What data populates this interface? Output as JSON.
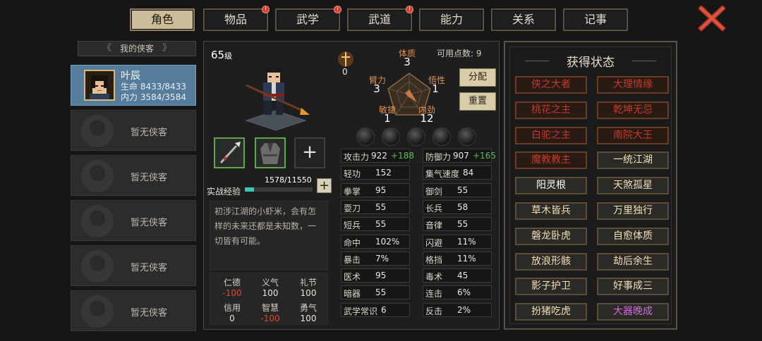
{
  "tabs": [
    {
      "label": "角色",
      "active": true,
      "badge": false
    },
    {
      "label": "物品",
      "active": false,
      "badge": true
    },
    {
      "label": "武学",
      "active": false,
      "badge": true
    },
    {
      "label": "武道",
      "active": false,
      "badge": true
    },
    {
      "label": "能力",
      "active": false,
      "badge": false
    },
    {
      "label": "关系",
      "active": false,
      "badge": false
    },
    {
      "label": "记事",
      "active": false,
      "badge": false
    }
  ],
  "badge_mark": "!",
  "roster": {
    "title": "我的侠客",
    "hero": {
      "name": "叶辰",
      "hp_label": "生命",
      "hp_value": "8433/8433",
      "mp_label": "内力",
      "mp_value": "3584/3584"
    },
    "empty_label": "暂无侠客",
    "empty_slots": 5
  },
  "character": {
    "level": "65",
    "level_suffix": "级",
    "exp_label": "实战经验",
    "exp_text": "1578/11550",
    "exp_current": 1578,
    "exp_max": 11550,
    "description": "初涉江湖的小虾米，会有怎样的未来还都是未知数，一切皆有可能。",
    "icon_value": "0"
  },
  "virtues": [
    {
      "label": "仁德",
      "value": "-100",
      "neg": true
    },
    {
      "label": "义气",
      "value": "100",
      "neg": false
    },
    {
      "label": "礼节",
      "value": "100",
      "neg": false
    },
    {
      "label": "信用",
      "value": "0",
      "neg": false
    },
    {
      "label": "智慧",
      "value": "-100",
      "neg": true
    },
    {
      "label": "勇气",
      "value": "100",
      "neg": false
    }
  ],
  "radar": {
    "available_points_label": "可用点数",
    "available_points": "9",
    "attributes": [
      {
        "label": "体质",
        "value": "3"
      },
      {
        "label": "悟性",
        "value": "1"
      },
      {
        "label": "内劲",
        "value": "12"
      },
      {
        "label": "敏捷",
        "value": "1"
      },
      {
        "label": "臂力",
        "value": "3"
      }
    ]
  },
  "buttons": {
    "allocate": "分配",
    "reset": "重置"
  },
  "stats": [
    {
      "label": "攻击力",
      "value": "922",
      "bonus": "+188"
    },
    {
      "label": "防御力",
      "value": "907",
      "bonus": "+165"
    },
    {
      "label": "轻功",
      "value": "152",
      "bonus": ""
    },
    {
      "label": "集气速度",
      "value": "84",
      "bonus": ""
    },
    {
      "label": "拳掌",
      "value": "95",
      "bonus": ""
    },
    {
      "label": "御剑",
      "value": "55",
      "bonus": ""
    },
    {
      "label": "耍刀",
      "value": "55",
      "bonus": ""
    },
    {
      "label": "长兵",
      "value": "58",
      "bonus": ""
    },
    {
      "label": "短兵",
      "value": "55",
      "bonus": ""
    },
    {
      "label": "音律",
      "value": "55",
      "bonus": ""
    },
    {
      "label": "命中",
      "value": "102%",
      "bonus": ""
    },
    {
      "label": "闪避",
      "value": "11%",
      "bonus": ""
    },
    {
      "label": "暴击",
      "value": "7%",
      "bonus": ""
    },
    {
      "label": "格挡",
      "value": "11%",
      "bonus": ""
    },
    {
      "label": "医术",
      "value": "95",
      "bonus": ""
    },
    {
      "label": "毒术",
      "value": "45",
      "bonus": ""
    },
    {
      "label": "暗器",
      "value": "55",
      "bonus": ""
    },
    {
      "label": "连击",
      "value": "6%",
      "bonus": ""
    },
    {
      "label": "武学常识",
      "value": "6",
      "bonus": ""
    },
    {
      "label": "反击",
      "value": "2%",
      "bonus": ""
    }
  ],
  "status_panel": {
    "title": "获得状态",
    "items": [
      {
        "label": "侠之大者",
        "style": "red"
      },
      {
        "label": "大理情缘",
        "style": "red"
      },
      {
        "label": "桃花之主",
        "style": "red"
      },
      {
        "label": "乾坤无忌",
        "style": "red"
      },
      {
        "label": "白驼之主",
        "style": "red"
      },
      {
        "label": "南院大王",
        "style": "red"
      },
      {
        "label": "魔教教主",
        "style": "red"
      },
      {
        "label": "一统江湖",
        "style": "gold"
      },
      {
        "label": "阳灵根",
        "style": "white"
      },
      {
        "label": "天煞孤星",
        "style": "gold"
      },
      {
        "label": "草木皆兵",
        "style": "gold"
      },
      {
        "label": "万里独行",
        "style": "gold"
      },
      {
        "label": "磐龙卧虎",
        "style": "gold"
      },
      {
        "label": "自愈体质",
        "style": "gold"
      },
      {
        "label": "放浪形骸",
        "style": "gold"
      },
      {
        "label": "劫后余生",
        "style": "gold"
      },
      {
        "label": "影子护卫",
        "style": "gold"
      },
      {
        "label": "好事成三",
        "style": "gold"
      },
      {
        "label": "扮猪吃虎",
        "style": "gold"
      },
      {
        "label": "大器晚成",
        "style": "purple"
      }
    ]
  }
}
